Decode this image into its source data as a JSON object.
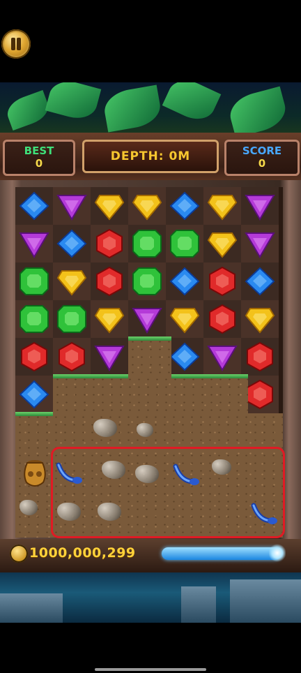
{
  "hud": {
    "best_label": "BEST",
    "best_value": "0",
    "depth_text": "DEPTH: 0M",
    "score_label": "SCORE",
    "score_value": "0"
  },
  "wallet": {
    "coins": "1000,000,299",
    "meter_level_percent": 100
  },
  "colors": {
    "best_label": "#3fe07a",
    "score_label": "#48a8ff",
    "highlight_border": "#e01a24"
  },
  "icons": {
    "pause": "pause-icon",
    "coin": "coin-icon",
    "artifact": "clay-pot-icon",
    "pickup": "magic-wand-icon"
  },
  "board": {
    "columns": 7,
    "rows": [
      [
        "blue",
        "purple",
        "yellow",
        "yellow",
        "blue",
        "yellow",
        "purple"
      ],
      [
        "purple",
        "blue",
        "red",
        "green",
        "green",
        "yellow",
        "purple"
      ],
      [
        "green",
        "yellow",
        "red",
        "green",
        "blue",
        "red",
        "blue"
      ],
      [
        "green",
        "green",
        "yellow",
        "purple",
        "yellow",
        "red",
        "yellow"
      ],
      [
        "red",
        "red",
        "purple",
        "dirt",
        "blue",
        "purple",
        "red"
      ],
      [
        "blue",
        "dirt",
        "dirt",
        "dirt",
        "dirt",
        "dirt",
        "red"
      ]
    ]
  }
}
